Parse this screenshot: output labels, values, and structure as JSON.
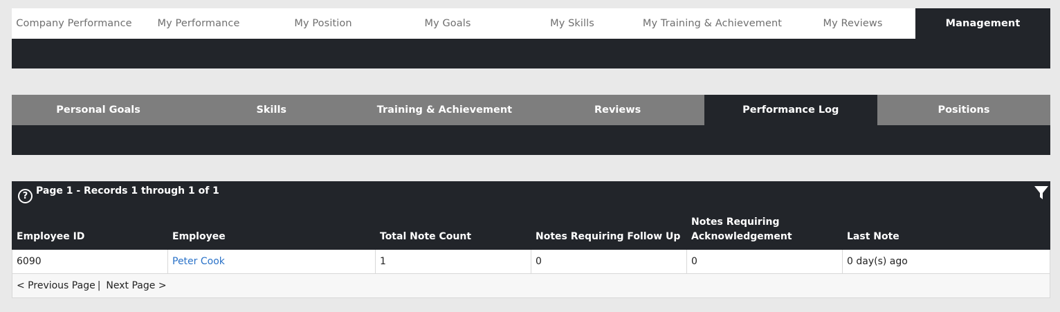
{
  "top_nav": {
    "tabs": [
      {
        "label": "Company Performance",
        "active": false
      },
      {
        "label": "My Performance",
        "active": false
      },
      {
        "label": "My Position",
        "active": false
      },
      {
        "label": "My Goals",
        "active": false
      },
      {
        "label": "My Skills",
        "active": false
      },
      {
        "label": "My Training & Achievement",
        "active": false
      },
      {
        "label": "My Reviews",
        "active": false
      },
      {
        "label": "Management",
        "active": true
      }
    ]
  },
  "sub_nav": {
    "tabs": [
      {
        "label": "Personal Goals",
        "active": false
      },
      {
        "label": "Skills",
        "active": false
      },
      {
        "label": "Training & Achievement",
        "active": false
      },
      {
        "label": "Reviews",
        "active": false
      },
      {
        "label": "Performance Log",
        "active": true
      },
      {
        "label": "Positions",
        "active": false
      }
    ]
  },
  "grid": {
    "help_icon": "question-circle-icon",
    "help_glyph": "?",
    "paging_text": "Page 1 - Records 1 through 1 of 1",
    "filter_icon": "filter-icon",
    "columns": {
      "employee_id": "Employee ID",
      "employee": "Employee",
      "total_note_count": "Total Note Count",
      "notes_follow_up": "Notes Requiring Follow Up",
      "notes_ack_line1": "Notes Requiring",
      "notes_ack_line2": "Acknowledgement",
      "last_note": "Last Note"
    },
    "rows": [
      {
        "employee_id": "6090",
        "employee": "Peter Cook",
        "total_note_count": "1",
        "notes_follow_up": "0",
        "notes_ack": "0",
        "last_note": "0 day(s) ago"
      }
    ],
    "pager": {
      "previous_label": "< Previous Page",
      "separator": "|",
      "next_label": "Next Page >"
    }
  },
  "colors": {
    "dark": "#22252a",
    "subnav_gray": "#7e7e7e",
    "link_blue": "#2a72c8",
    "background": "#e9e9e9"
  }
}
